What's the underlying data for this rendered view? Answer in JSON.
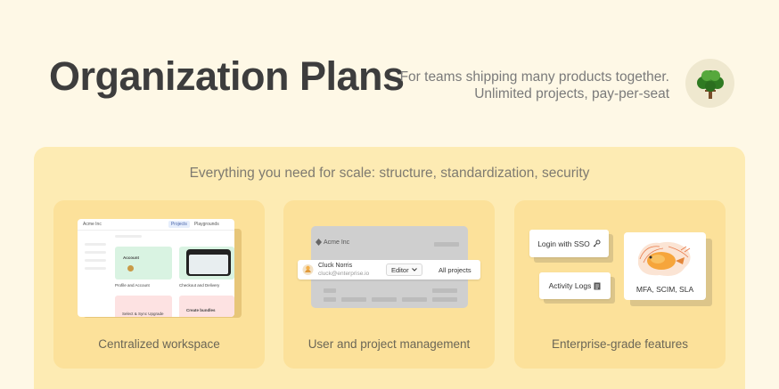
{
  "header": {
    "title": "Organization Plans",
    "tagline_line1": "For teams shipping many products together.",
    "tagline_line2": "Unlimited projects, pay-per-seat"
  },
  "panel": {
    "heading": "Everything you need for scale: structure, standardization, security"
  },
  "cards": [
    {
      "label": "Centralized workspace",
      "preview": {
        "org": "Acme Inc",
        "tab_projects": "Projects",
        "tab_playgrounds": "Playgrounds",
        "tiles": [
          {
            "title": "Account",
            "caption": "Profile and Account"
          },
          {
            "title": "",
            "caption": "Checkout and Delivery"
          },
          {
            "title": "Select & Sync Upgrade",
            "caption": ""
          },
          {
            "title": "Create bundles",
            "caption": ""
          }
        ]
      }
    },
    {
      "label": "User and project management",
      "preview": {
        "org": "Acme Inc",
        "user_name": "Cluck Norris",
        "user_email": "cluck@enterprise.io",
        "role": "Editor",
        "scope": "All projects"
      }
    },
    {
      "label": "Enterprise-grade features",
      "preview": {
        "sso": "Login with SSO",
        "logs": "Activity Logs",
        "mfa": "MFA, SCIM, SLA"
      }
    }
  ],
  "colors": {
    "background": "#fef8e6",
    "panel": "#fdebb3",
    "card": "#fce19a",
    "tile_green": "#d9f3e2",
    "tile_pink": "#fde2e2"
  },
  "icons": [
    "tree-icon",
    "key-icon",
    "document-icon",
    "chevron-down-icon",
    "avatar-icon",
    "cushion-illustration-icon"
  ]
}
